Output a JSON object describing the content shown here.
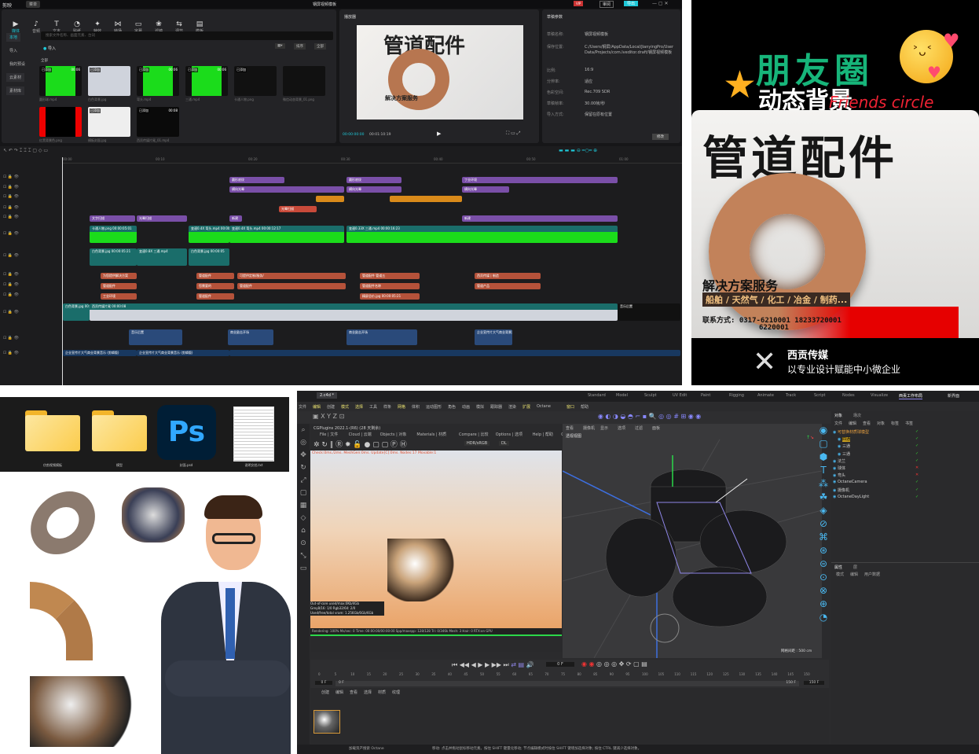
{
  "editor": {
    "app_name": "剪映",
    "menu": "菜单",
    "project_title": "钢屏视频模板",
    "top_buttons": {
      "share": "审阅",
      "export": "导出",
      "vip": "VIP"
    },
    "tools": [
      "媒体",
      "音频",
      "文本",
      "贴纸",
      "特效",
      "转场",
      "字幕",
      "滤镜",
      "调节",
      "模板"
    ],
    "side_nav": [
      "本地",
      "导入",
      "我的预设",
      "云素材",
      "素材库"
    ],
    "search_placeholder": "搜索文件名称、画面元素、台词",
    "import_label": "导入",
    "all_label": "全部",
    "sort_label": "排序",
    "filter_label": "全部",
    "media": [
      {
        "name": "圆形球.mp4",
        "badge": "已添加",
        "dur": "00:06",
        "color": "#1bdc1b"
      },
      {
        "name": "白色背景.jpg",
        "badge": "已添加",
        "dur": "",
        "color": "#cfd3dc"
      },
      {
        "name": "弯头.mp4",
        "badge": "已添加",
        "dur": "00:06",
        "color": "#1bdc1b"
      },
      {
        "name": "三通.mp4",
        "badge": "已添加",
        "dur": "00:06",
        "color": "#1bdc1b"
      },
      {
        "name": "卡通人物.png",
        "badge": "已添加",
        "dur": "",
        "color": "#111"
      },
      {
        "name": "微信动态背景_01.png",
        "badge": "",
        "dur": "",
        "color": "#111"
      },
      {
        "name": "红黑背景色.png",
        "badge": "",
        "dur": "",
        "color": "#000"
      },
      {
        "name": "模板封面.jpg",
        "badge": "已添加",
        "dur": "",
        "color": "#eee"
      },
      {
        "name": "西贡传媒片尾_01.mp4",
        "badge": "已添加",
        "dur": "00:08",
        "color": "#0a0a0a"
      }
    ],
    "player": {
      "title": "播放器",
      "current": "00:00:00:00",
      "total": "00:01:10:19",
      "preview_title": "管道配件",
      "preview_sub": "解决方案服务"
    },
    "params": {
      "title": "草稿参数",
      "rows": [
        {
          "k": "草稿名称:",
          "v": "钢屏视频模板"
        },
        {
          "k": "保存位置:",
          "v": "C:/Users/钢屏/AppData/Local/JianyingPro/User Data/Projects/com.lveditor.draft/钢屏视频模板"
        },
        {
          "k": "比例:",
          "v": "16:9"
        },
        {
          "k": "分辨率:",
          "v": "适应"
        },
        {
          "k": "色彩空间:",
          "v": "Rec.709 SDR"
        },
        {
          "k": "草稿帧率:",
          "v": "30.00帧/秒"
        },
        {
          "k": "导入方式:",
          "v": "保留在原有位置"
        }
      ],
      "edit_button": "修改"
    },
    "ruler": [
      "00:00",
      "00:10",
      "00:20",
      "00:30",
      "00:40",
      "00:50",
      "01:00",
      "01:10"
    ],
    "clips": [
      "圆形底纹",
      "圆形底纹",
      "丁业环境",
      "横向光晕",
      "横向光晕",
      "横向光晕",
      "",
      "",
      "光晕扫描",
      "文字扫描",
      "光晕扫描",
      "新建",
      "新建",
      "卡通人物.png 00:00:05:01",
      "变速0.4X 弯头.mp4 00:00:12:17",
      "变速0.4X 弯头.mp4 00:00:12:17",
      "变速0.33X 三通.mp4 00:00:16:23",
      "白色背景.jpg 00:00:05:21",
      "变速0.8X 三通.mp4",
      "白色背景.jpg 00:00:05",
      "为您提供解决方案",
      "管道配件",
      "可提供定制/服务/",
      "管道配件 管道五",
      "西贡传媒 | 制造",
      "管道配件",
      "您需要的",
      "管道配件",
      "管道配件名称",
      "管道产品",
      "工业环境",
      "管道配件",
      "精屏总价.jpg 00:00:05:21",
      "白色背景.jpg 00:00:51:27",
      "西贡传媒片尾 00:00:08",
      "音乐后置",
      "音乐后置",
      "商业励志开场",
      "商业励志开场",
      "企业宣传片大气商业背景音乐 (剪辑版)",
      "企业宣传片大气商业背景音乐 (剪辑版)",
      "企业宣传片大气商业背景音乐 (剪辑版)"
    ]
  },
  "poster": {
    "title_green": "朋友圈",
    "title_white": "动态背景",
    "title_script": "Friends circle",
    "headline": "管道配件",
    "service": "解决方案服务",
    "industries": "船舶 / 天然气 / 化工 / 冶金 / 制药...",
    "contact": "联系方式: 0317-6210001 18233720001",
    "contact2": "6220001",
    "brand": "西贡传媒",
    "slogan": "以专业设计赋能中小微企业",
    "accent": "#e60000"
  },
  "files": [
    {
      "name": "仿剪视频模板",
      "type": "folder"
    },
    {
      "name": "模型",
      "type": "folder"
    },
    {
      "name": "封面.psd",
      "type": "psd",
      "glyph": "Ps"
    },
    {
      "name": "说明文档.txt",
      "type": "txt"
    }
  ],
  "c4d": {
    "tab": "2.c4d *",
    "layouts": [
      "Standard",
      "Model",
      "Sculpt",
      "UV Edit",
      "Paint",
      "Rigging",
      "Animate",
      "Track",
      "Script",
      "Nodes",
      "Visualize",
      "西贡工作布局"
    ],
    "new_layout": "新界面",
    "menu": [
      "文件",
      "编辑",
      "创建",
      "模式",
      "选择",
      "工具",
      "样条",
      "网格",
      "体积",
      "运动图形",
      "角色",
      "动画",
      "模拟",
      "跟踪器",
      "渲染",
      "扩展",
      "Octane",
      "窗口",
      "帮助"
    ],
    "octane_title": "CGPlugins  2022.1-(R6) (28 天剩余)",
    "octane_menu": [
      "File | 文件",
      "Cloud | 云端",
      "Objects | 对象",
      "Materials | 材质",
      "Compare | 比较",
      "Options | 选项",
      "Help | 帮助",
      "GUI | 界面"
    ],
    "color_mode": "HDR/sRGB",
    "kernel": "DL",
    "status_line": "Check:0ms./2ms. MeshGen:0ms. Update[C]:0ms. Nodes:17 Movable:1",
    "stats": [
      "Out-of-core used/max:0Kb/4Gb",
      "Grey8/16: 1/0     Rgb32/64: 2/0",
      "Used/free/total vram: 1.256Gb/6Gb/6Gb"
    ],
    "render_line": "Rendering: 100%  Ms/sec: 0  Time: 00:00:00/00:00:00  Spp/maxspp: 128/128  Tri: 0/346k  Mesh: 3  Hair: 0  RTX:on  GPU",
    "viewport_label": "透视视图",
    "viewport_menu": [
      "查看",
      "摄像机",
      "显示",
      "选项",
      "过滤",
      "面板"
    ],
    "grid_label": "网格间距 : 500 cm",
    "obj_tabs": [
      "对象",
      "场次"
    ],
    "obj_menu": [
      "文件",
      "编辑",
      "查看",
      "对象",
      "标签",
      "书签"
    ],
    "objects": [
      "可替换材质球模型",
      "四通",
      "三通",
      "三通",
      "法兰",
      "球体",
      "弯头",
      "OctaneCamera",
      "摄像机",
      "OctaneDayLight"
    ],
    "attr_tabs": [
      "属性",
      "层"
    ],
    "attr_menu": [
      "模式",
      "编辑",
      "用户数据"
    ],
    "frame": "0 F",
    "start": "0 F",
    "end": "150 F",
    "end2": "150 F",
    "ticks": [
      "0",
      "5",
      "10",
      "15",
      "20",
      "25",
      "30",
      "35",
      "40",
      "45",
      "50",
      "55",
      "60",
      "65",
      "70",
      "75",
      "80",
      "85",
      "90",
      "95",
      "100",
      "105",
      "110",
      "115",
      "120",
      "125",
      "130",
      "135",
      "140",
      "145",
      "150"
    ],
    "mat_menu": [
      "创建",
      "编辑",
      "查看",
      "选择",
      "材质",
      "纹理"
    ],
    "status_left": "加载资产搜索 Octane",
    "status_hint": "移动: 点击并拖动鼠标移动元素。按住 SHIFT 键量化移动; 节点编辑模式时按住 SHIFT 键增加选择对象; 按住 CTRL 键减少选择对象。"
  }
}
